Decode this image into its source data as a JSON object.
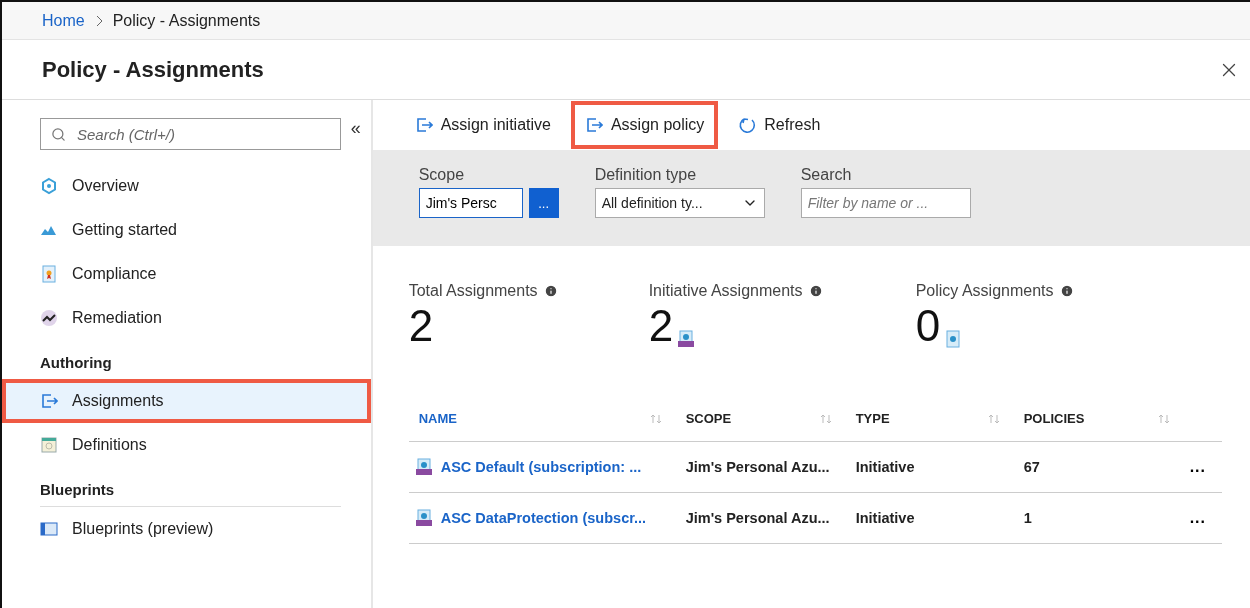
{
  "breadcrumb": [
    {
      "label": "Home",
      "kind": "link"
    },
    {
      "label": "Policy - Assignments",
      "kind": "current"
    }
  ],
  "title": "Policy - Assignments",
  "sidebar": {
    "search": {
      "placeholder": "Search (Ctrl+/)"
    },
    "collapse": "«",
    "groups": [
      {
        "items": [
          {
            "label": "Overview",
            "kind": "overview",
            "selected": false,
            "highlighted": false
          },
          {
            "label": "Getting started",
            "kind": "cloud",
            "selected": false,
            "highlighted": false
          },
          {
            "label": "Compliance",
            "kind": "compliance",
            "selected": false,
            "highlighted": false
          },
          {
            "label": "Remediation",
            "kind": "remediation",
            "selected": false,
            "highlighted": false
          }
        ]
      },
      {
        "heading": "Authoring",
        "items": [
          {
            "label": "Assignments",
            "kind": "assign",
            "selected": true,
            "highlighted": true
          },
          {
            "label": "Definitions",
            "kind": "definitions",
            "selected": false,
            "highlighted": false
          }
        ]
      },
      {
        "heading": "Blueprints",
        "items": [
          {
            "label": "Blueprints (preview)",
            "kind": "blueprint",
            "selected": false,
            "highlighted": false
          }
        ]
      }
    ]
  },
  "toolbar": [
    {
      "label": "Assign initiative",
      "kind": "assign",
      "highlighted": false
    },
    {
      "label": "Assign policy",
      "kind": "assign",
      "highlighted": true
    },
    {
      "label": "Refresh",
      "kind": "refresh",
      "highlighted": false
    }
  ],
  "filters": {
    "scope": {
      "label": "Scope",
      "value": "Jim's Persc",
      "button": "..."
    },
    "definition_type": {
      "label": "Definition type",
      "value": "All definition ty..."
    },
    "search": {
      "label": "Search",
      "placeholder": "Filter by name or ..."
    }
  },
  "stats": [
    {
      "label": "Total Assignments",
      "value": "2",
      "kind": "total"
    },
    {
      "label": "Initiative Assignments",
      "value": "2",
      "kind": "initiative"
    },
    {
      "label": "Policy Assignments",
      "value": "0",
      "kind": "policy"
    }
  ],
  "table": {
    "columns": [
      {
        "label": "NAME",
        "sorted": true
      },
      {
        "label": "SCOPE",
        "sorted": false
      },
      {
        "label": "TYPE",
        "sorted": false
      },
      {
        "label": "POLICIES",
        "sorted": false
      }
    ],
    "rows": [
      {
        "name": "ASC Default (subscription: ...",
        "scope": "Jim's Personal Azu...",
        "type": "Initiative",
        "policies": "67",
        "more": "..."
      },
      {
        "name": "ASC DataProtection (subscr...",
        "scope": "Jim's Personal Azu...",
        "type": "Initiative",
        "policies": "1",
        "more": "..."
      }
    ]
  }
}
